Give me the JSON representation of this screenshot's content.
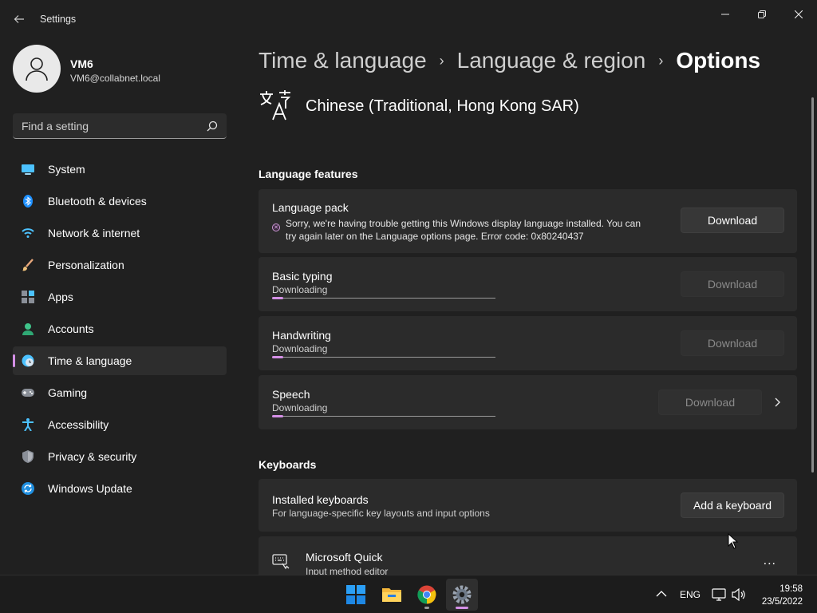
{
  "window": {
    "title": "Settings",
    "controls": {
      "minimize": "minimize-icon",
      "maximize": "restore-icon",
      "close": "close-icon"
    }
  },
  "profile": {
    "name": "VM6",
    "email": "VM6@collabnet.local"
  },
  "search": {
    "placeholder": "Find a setting"
  },
  "sidebar": {
    "items": [
      {
        "label": "System",
        "icon": "monitor-icon",
        "active": false
      },
      {
        "label": "Bluetooth & devices",
        "icon": "bluetooth-icon",
        "active": false
      },
      {
        "label": "Network & internet",
        "icon": "wifi-icon",
        "active": false
      },
      {
        "label": "Personalization",
        "icon": "brush-icon",
        "active": false
      },
      {
        "label": "Apps",
        "icon": "apps-icon",
        "active": false
      },
      {
        "label": "Accounts",
        "icon": "person-icon",
        "active": false
      },
      {
        "label": "Time & language",
        "icon": "globe-clock-icon",
        "active": true
      },
      {
        "label": "Gaming",
        "icon": "gamepad-icon",
        "active": false
      },
      {
        "label": "Accessibility",
        "icon": "accessibility-icon",
        "active": false
      },
      {
        "label": "Privacy & security",
        "icon": "shield-icon",
        "active": false
      },
      {
        "label": "Windows Update",
        "icon": "update-icon",
        "active": false
      }
    ]
  },
  "breadcrumb": {
    "items": [
      "Time & language",
      "Language & region"
    ],
    "current": "Options"
  },
  "language": {
    "name": "Chinese (Traditional, Hong Kong SAR)"
  },
  "features": {
    "section_title": "Language features",
    "language_pack": {
      "title": "Language pack",
      "error": "Sorry, we're having trouble getting this Windows display language installed. You can try again later on the Language options page. Error code: 0x80240437",
      "button": "Download"
    },
    "basic_typing": {
      "title": "Basic typing",
      "status": "Downloading",
      "button": "Download",
      "progress": 0.05
    },
    "handwriting": {
      "title": "Handwriting",
      "status": "Downloading",
      "button": "Download",
      "progress": 0.05
    },
    "speech": {
      "title": "Speech",
      "status": "Downloading",
      "button": "Download",
      "progress": 0.05
    }
  },
  "keyboards": {
    "section_title": "Keyboards",
    "installed": {
      "title": "Installed keyboards",
      "subtitle": "For language-specific key layouts and input options",
      "button": "Add a keyboard"
    },
    "ime": {
      "title": "Microsoft Quick",
      "subtitle": "Input method editor",
      "more": "..."
    }
  },
  "taskbar": {
    "apps": [
      "start-icon",
      "file-explorer-icon",
      "chrome-icon",
      "settings-icon"
    ],
    "lang": "ENG",
    "time": "19:58",
    "date": "23/5/2022"
  },
  "colors": {
    "accent": "#d490e6",
    "background": "#202020",
    "card": "#2b2b2b"
  }
}
